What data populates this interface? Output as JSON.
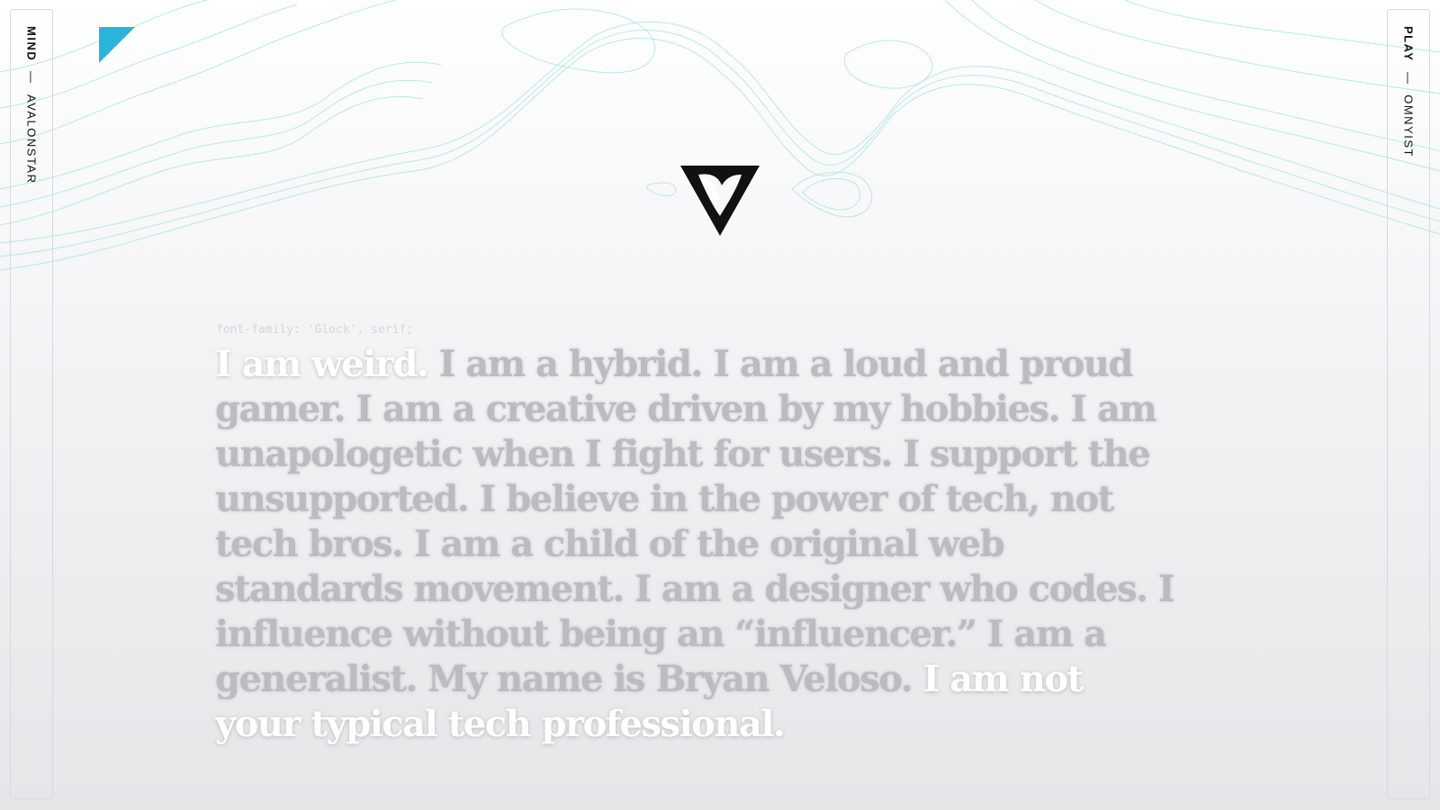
{
  "left_rail": {
    "strong": "MIND",
    "dash": "—",
    "label": "AVALONSTAR"
  },
  "right_rail": {
    "strong": "PLAY",
    "dash": "—",
    "label": "OMNYIST"
  },
  "code_hint": "font-family: 'Glock', serif;",
  "manifesto": {
    "lead": "I am weird.",
    "body": " I am a hybrid. I am a loud and proud gamer. I am a creative driven by my hobbies. I am unapologetic when I fight for users. I support the unsupported. I believe in the power of tech, not tech bros. I am a child of the original web standards movement. I am a designer who codes. I influence without being an “influencer.” I am a generalist. My name is Bryan Veloso.",
    "closing": " I am not your typical tech professional."
  },
  "colors": {
    "accent": "#2bb3d9",
    "topo_line": "#9fe3de",
    "text_muted": "#bcbcc0",
    "text_highlight": "#ffffff"
  },
  "icons": {
    "corner_mark": "triangle-flag-icon",
    "logo": "v-monogram-logo"
  }
}
